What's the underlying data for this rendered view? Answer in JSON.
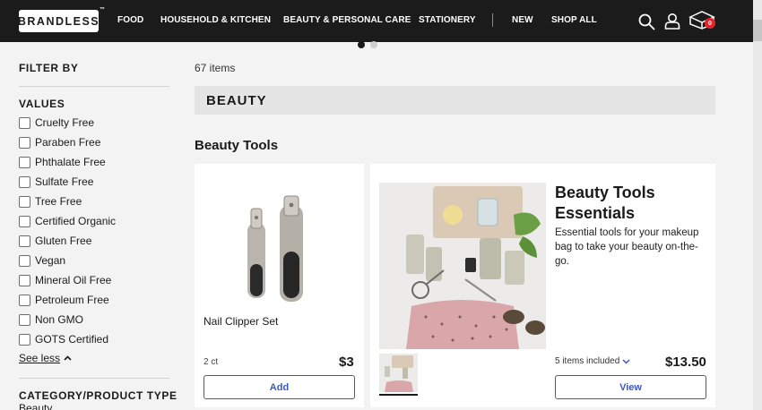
{
  "header": {
    "logo": "BRANDLESS",
    "trademark": "™",
    "nav": [
      "FOOD",
      "HOUSEHOLD & KITCHEN",
      "BEAUTY & PERSONAL CARE",
      "STATIONERY",
      "NEW",
      "SHOP ALL"
    ],
    "cart_count": "0",
    "icons": [
      "search-icon",
      "user-icon",
      "cart-box-icon"
    ]
  },
  "carousel": {
    "active_dot": 1,
    "total_dots": 2
  },
  "sidebar": {
    "filter_by": "FILTER BY",
    "values_heading": "VALUES",
    "options": [
      "Cruelty Free",
      "Paraben Free",
      "Phthalate Free",
      "Sulfate Free",
      "Tree Free",
      "Certified Organic",
      "Gluten Free",
      "Vegan",
      "Mineral Oil Free",
      "Petroleum Free",
      "Non GMO",
      "GOTS Certified"
    ],
    "see_less": "See less",
    "category_heading": "CATEGORY/PRODUCT TYPE",
    "category_value": "Beauty"
  },
  "main": {
    "item_count": "67 items",
    "banner_title": "BEAUTY",
    "section_title": "Beauty Tools",
    "product": {
      "name": "Nail Clipper Set",
      "quantity": "2 ct",
      "price": "$3",
      "button": "Add"
    },
    "kit": {
      "title": "Beauty Tools Essentials",
      "description": "Essential tools for your makeup bag to take your beauty on-the-go.",
      "included": "5 items included",
      "price": "$13.50",
      "button": "View"
    }
  },
  "colors": {
    "header_bg": "#1b1b1b",
    "accent_blue": "#3a57c4",
    "badge_red": "#e4242d",
    "banner_bg": "#e5e5e5"
  }
}
